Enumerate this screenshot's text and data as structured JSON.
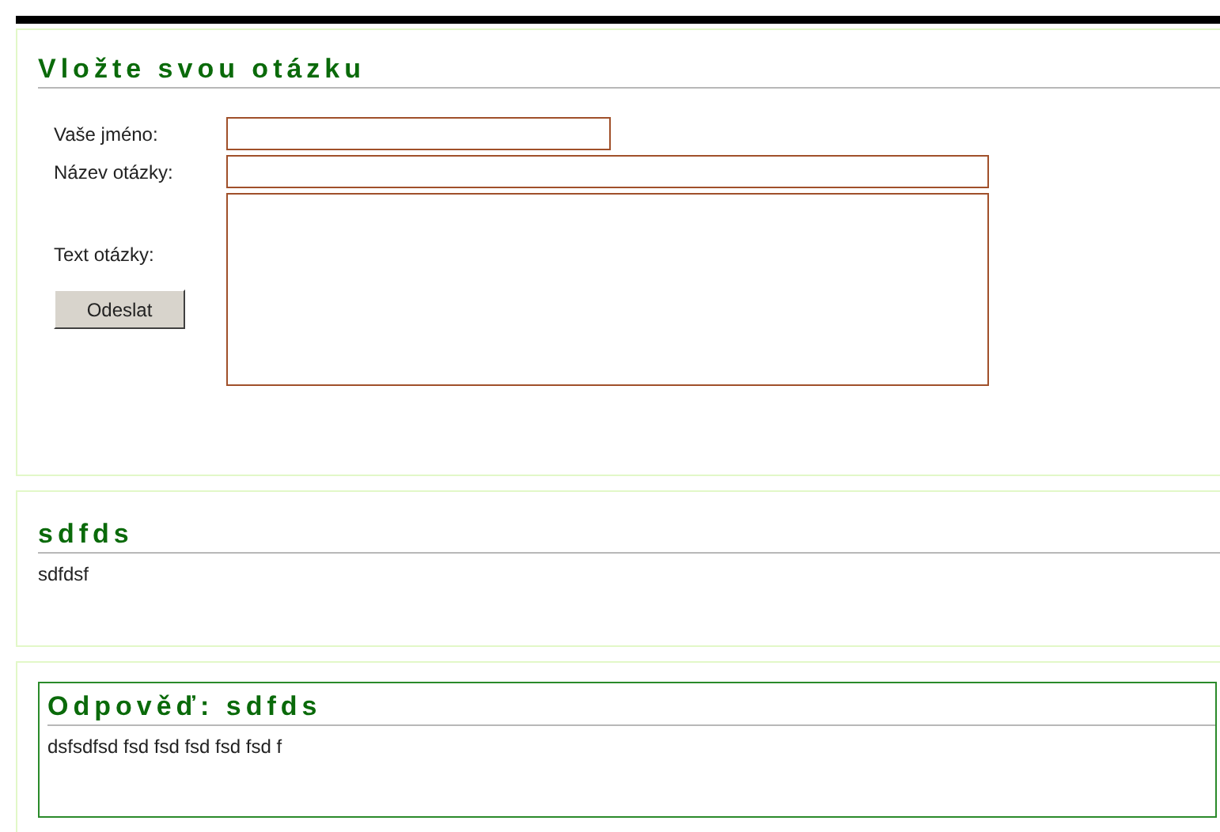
{
  "form": {
    "title": "Vložte svou otázku",
    "fields": [
      {
        "kind": "short_input",
        "label": "Vaše jméno:"
      },
      {
        "kind": "input",
        "label": "Název otázky:"
      },
      {
        "kind": "textarea",
        "label": "Text otázky:"
      }
    ],
    "submit": "Odeslat"
  },
  "question": {
    "title": "sdfds",
    "body": "sdfdsf"
  },
  "answer": {
    "title": "Odpověď: sdfds",
    "body": "dsfsdfsd fsd fsd fsd fsd fsd f"
  }
}
